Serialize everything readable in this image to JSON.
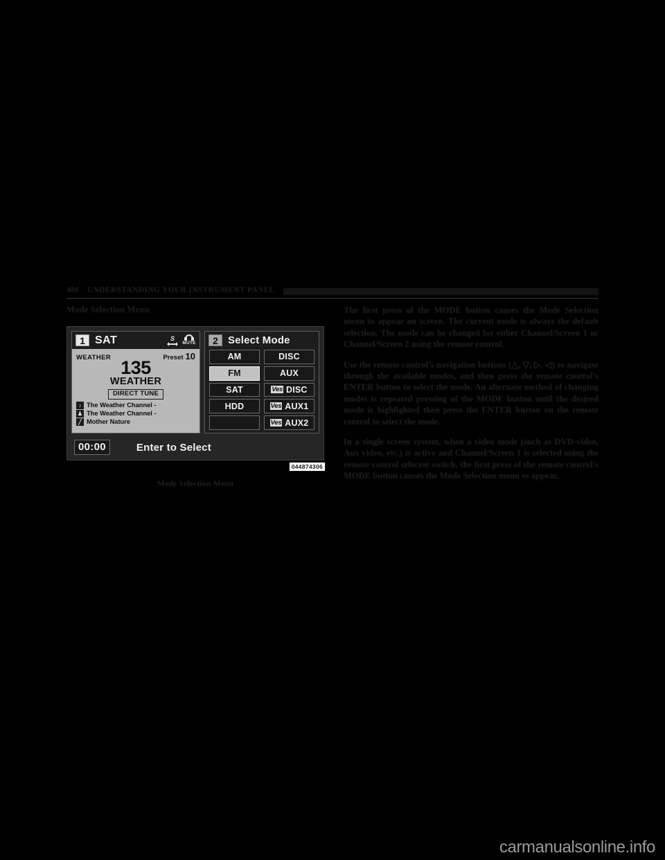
{
  "running_head": {
    "page_number": "400",
    "title": "UNDERSTANDING YOUR INSTRUMENT PANEL"
  },
  "left_column": {
    "subheading": "Mode Selection Menu",
    "figure": {
      "id_tag": "044874306",
      "caption": "Mode Selection Menu",
      "sat_display": {
        "channel_badge": "1",
        "source": "SAT",
        "scan_icon": "scan-icon",
        "mute_icon": "mute-headphone-icon",
        "mute_label": "MUTE",
        "category": "WEATHER",
        "preset_label": "Preset",
        "preset_value": "10",
        "channel_number": "135",
        "channel_name": "WEATHER",
        "direct_tune_label": "DIRECT TUNE",
        "info_rows": [
          {
            "icon": "music-note-icon",
            "glyph": "♪",
            "text": "The Weather Channel -"
          },
          {
            "icon": "artist-person-icon",
            "glyph": "♟",
            "text": "The Weather Channel -"
          },
          {
            "icon": "title-pen-icon",
            "glyph": "╱",
            "text": "Mother Nature"
          }
        ]
      },
      "mode_display": {
        "channel_badge": "2",
        "title": "Select Mode",
        "buttons": [
          {
            "label": "AM",
            "ves": "",
            "selected": false,
            "empty": false
          },
          {
            "label": "DISC",
            "ves": "",
            "selected": false,
            "empty": false
          },
          {
            "label": "FM",
            "ves": "",
            "selected": true,
            "empty": false
          },
          {
            "label": "AUX",
            "ves": "",
            "selected": false,
            "empty": false
          },
          {
            "label": "SAT",
            "ves": "",
            "selected": false,
            "empty": false
          },
          {
            "label": "DISC",
            "ves": "Ves",
            "selected": false,
            "empty": false
          },
          {
            "label": "HDD",
            "ves": "",
            "selected": false,
            "empty": false
          },
          {
            "label": "AUX1",
            "ves": "Ves",
            "selected": false,
            "empty": false
          },
          {
            "label": "",
            "ves": "",
            "selected": false,
            "empty": true
          },
          {
            "label": "AUX2",
            "ves": "Ves",
            "selected": false,
            "empty": false
          }
        ]
      },
      "status_bar": {
        "clock": "00:00",
        "hint": "Enter to Select"
      }
    }
  },
  "right_column": {
    "paragraphs": [
      "The first press of the MODE button causes the Mode Selection menu to appear on screen. The current mode is always the default selection. The mode can be changed for either Channel/Screen 1 or Channel/Screen 2 using the remote control.",
      "Use the remote control's navigation buttons (△, ▽, ▷, ◁) to navigate through the available modes, and then press the remote control's ENTER button to select the mode. An alternate method of changing modes is repeated pressing of the MODE button until the desired mode is highlighted then press the ENTER button on the remote control to select the mode.",
      "In a single screen system, when a video mode (such as DVD-video, Aux video, etc.) is active and Channel/Screen 1 is selected using the remote control selector switch, the first press of the remote control's MODE button causes the Mode Selection menu to appear."
    ]
  },
  "watermark": "carmanualsonline.info",
  "colors": {
    "page_background": "#000000",
    "ink": "#231f20",
    "screen_dark": "#1d1d1d",
    "screen_light": "#b8b8b8",
    "selected_button": "#c2c2c2",
    "watermark": "#9a9a9a"
  }
}
